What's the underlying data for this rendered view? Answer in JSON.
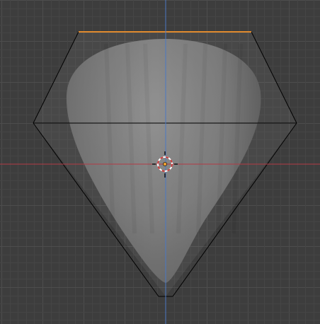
{
  "viewport": {
    "background_color": "#3d3d3d",
    "grid_minor_color": "#454545",
    "grid_major_color": "#4d4d4d",
    "axis_x_color": "#b33a45",
    "axis_z_color": "#4a78c4",
    "mesh_fill_color": "#7a7a7a",
    "cage_edge_color": "#000000",
    "selected_edge_color": "#e08a2e",
    "cursor_ring_colors": [
      "#ffffff",
      "#c83a3a"
    ],
    "origin_dot_color": "#f0a030"
  },
  "icons": {
    "3d_cursor": "3d-cursor-icon",
    "origin": "object-origin-icon"
  }
}
